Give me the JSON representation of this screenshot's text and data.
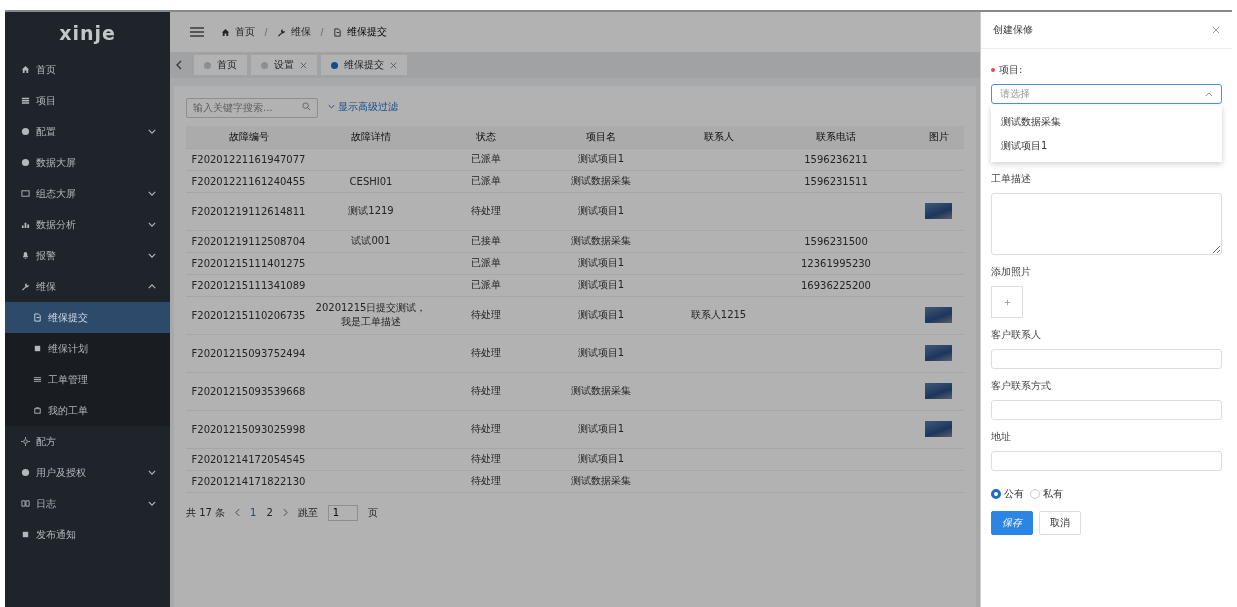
{
  "sidebar": {
    "logo": "xinje",
    "items": [
      {
        "label": "首页",
        "expandable": false,
        "selected": false
      },
      {
        "label": "项目",
        "expandable": false,
        "selected": false
      },
      {
        "label": "配置",
        "expandable": true,
        "expanded": false,
        "selected": false
      },
      {
        "label": "数据大屏",
        "expandable": false,
        "selected": false
      },
      {
        "label": "组态大屏",
        "expandable": true,
        "expanded": false,
        "selected": false
      },
      {
        "label": "数据分析",
        "expandable": true,
        "expanded": false,
        "selected": false
      },
      {
        "label": "报警",
        "expandable": true,
        "expanded": false,
        "selected": false
      },
      {
        "label": "维保",
        "expandable": true,
        "expanded": true,
        "selected": false,
        "children": [
          {
            "label": "维保提交",
            "selected": true
          },
          {
            "label": "维保计划",
            "selected": false
          },
          {
            "label": "工单管理",
            "selected": false
          },
          {
            "label": "我的工单",
            "selected": false
          }
        ]
      },
      {
        "label": "配方",
        "expandable": false,
        "selected": false
      },
      {
        "label": "用户及授权",
        "expandable": true,
        "expanded": false,
        "selected": false
      },
      {
        "label": "日志",
        "expandable": true,
        "expanded": false,
        "selected": false
      },
      {
        "label": "发布通知",
        "expandable": false,
        "selected": false
      }
    ]
  },
  "breadcrumb": [
    "首页",
    "维保",
    "维保提交"
  ],
  "tabs": [
    {
      "label": "首页",
      "selected": false,
      "closable": false
    },
    {
      "label": "设置",
      "selected": false,
      "closable": true
    },
    {
      "label": "维保提交",
      "selected": true,
      "closable": true
    }
  ],
  "search": {
    "placeholder": "输入关键字搜索...",
    "filter_link": "显示高级过滤"
  },
  "table": {
    "columns": [
      "故障编号",
      "故障详情",
      "状态",
      "项目名",
      "联系人",
      "联系电话",
      "图片"
    ],
    "rows": [
      {
        "cells": [
          "F20201221161947077",
          "",
          "已派单",
          "测试项目1",
          "",
          "1596236211"
        ],
        "photo": false
      },
      {
        "cells": [
          "F20201221161240455",
          "CESHI01",
          "已派单",
          "测试数据采集",
          "",
          "1596231511"
        ],
        "photo": false
      },
      {
        "cells": [
          "F20201219112614811",
          "测试1219",
          "待处理",
          "测试项目1",
          "",
          ""
        ],
        "photo": true
      },
      {
        "cells": [
          "F20201219112508704",
          "试试001",
          "已接单",
          "测试数据采集",
          "",
          "1596231500"
        ],
        "photo": false
      },
      {
        "cells": [
          "F20201215111401275",
          "",
          "已派单",
          "测试项目1",
          "",
          "12361995230"
        ],
        "photo": false
      },
      {
        "cells": [
          "F20201215111341089",
          "",
          "已派单",
          "测试项目1",
          "",
          "16936225200"
        ],
        "photo": false
      },
      {
        "cells": [
          "F20201215110206735",
          "20201215日提交测试，我是工单描述",
          "待处理",
          "测试项目1",
          "联系人1215",
          ""
        ],
        "photo": true
      },
      {
        "cells": [
          "F20201215093752494",
          "",
          "待处理",
          "测试项目1",
          "",
          ""
        ],
        "photo": true
      },
      {
        "cells": [
          "F20201215093539668",
          "",
          "待处理",
          "测试数据采集",
          "",
          ""
        ],
        "photo": true
      },
      {
        "cells": [
          "F20201215093025998",
          "",
          "待处理",
          "测试项目1",
          "",
          ""
        ],
        "photo": true
      },
      {
        "cells": [
          "F20201214172054545",
          "",
          "待处理",
          "测试项目1",
          "",
          ""
        ],
        "photo": false
      },
      {
        "cells": [
          "F20201214171822130",
          "",
          "待处理",
          "测试数据采集",
          "",
          ""
        ],
        "photo": false
      }
    ]
  },
  "pagination": {
    "total": "共 17 条",
    "pages": [
      {
        "label": "1",
        "selected": true
      },
      {
        "label": "2",
        "selected": false
      }
    ],
    "goto": "跳至",
    "value": "1",
    "unit": "页"
  },
  "drawer": {
    "title": "创建保修",
    "project": {
      "label": "项目:",
      "required": true,
      "placeholder": "请选择",
      "expanded": true,
      "options": [
        "测试数据采集",
        "测试项目1"
      ]
    },
    "description": {
      "label": "工单描述"
    },
    "photos": {
      "label": "添加照片"
    },
    "inputs": [
      "客户联系人",
      "客户联系方式",
      "地址"
    ],
    "visibility": [
      {
        "label": "公有",
        "selected": true
      },
      {
        "label": "私有",
        "selected": false
      }
    ],
    "buttons": [
      {
        "label": "保存",
        "kind": "primary"
      },
      {
        "label": "取消",
        "kind": "default"
      }
    ]
  }
}
